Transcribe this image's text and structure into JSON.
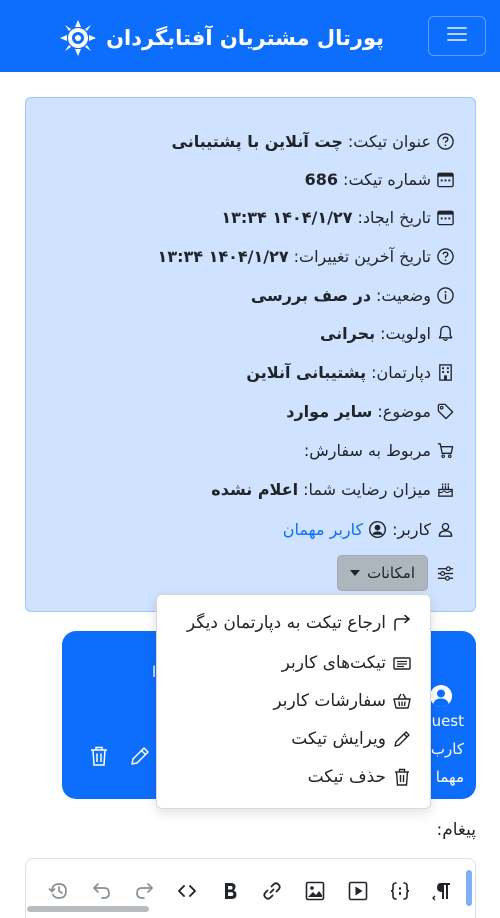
{
  "header": {
    "title": "پورتال مشتریان آفتابگردان",
    "menu_icon": "hamburger-menu-icon",
    "logo_icon": "sunflower-logo-icon",
    "bg_color": "#0d6efd"
  },
  "ticket": {
    "title_label": "عنوان تیکت:",
    "title_value": "چت آنلاین با پشتیبانی",
    "number_label": "شماره تیکت:",
    "number_value": "686",
    "created_label": "تاریخ ایجاد:",
    "created_value": "۱۴۰۴/۱/۲۷ ۱۳:۳۴",
    "updated_label": "تاریخ آخرین تغییرات:",
    "updated_value": "۱۴۰۴/۱/۲۷ ۱۳:۳۴",
    "status_label": "وضعیت:",
    "status_value": "در صف بررسی",
    "priority_label": "اولویت:",
    "priority_value": "بحرانی",
    "department_label": "دپارتمان:",
    "department_value": "پشتیبانی آنلاین",
    "subject_label": "موضوع:",
    "subject_value": "سایر موارد",
    "order_label": "مربوط به سفارش:",
    "satisfaction_label": "میزان رضایت شما:",
    "satisfaction_value": "اعلام نشده",
    "user_label": "کاربر:",
    "user_value": "کاربر مهمان",
    "options_label": "امکانات",
    "card_bg": "#cfe2ff"
  },
  "menu": {
    "items": [
      {
        "label": "ارجاع تیکت به دپارتمان دیگر",
        "icon": "forward-arrow-icon"
      },
      {
        "label": "تیکت‌های کاربر",
        "icon": "ticket-icon"
      },
      {
        "label": "سفارشات کاربر",
        "icon": "basket-icon"
      },
      {
        "label": "ویرایش تیکت",
        "icon": "pencil-icon"
      },
      {
        "label": "حذف تیکت",
        "icon": "trash-icon"
      }
    ]
  },
  "message_card": {
    "author_lines": [
      "uest",
      "کارب",
      "مهما"
    ],
    "bg_color": "#0d6efd"
  },
  "editor": {
    "message_label": "پیغام:",
    "tools": [
      "paragraph-icon",
      "code-block-icon",
      "video-icon",
      "image-icon",
      "link-icon",
      "bold-icon",
      "code-icon",
      "redo-icon",
      "undo-icon",
      "history-icon"
    ]
  }
}
